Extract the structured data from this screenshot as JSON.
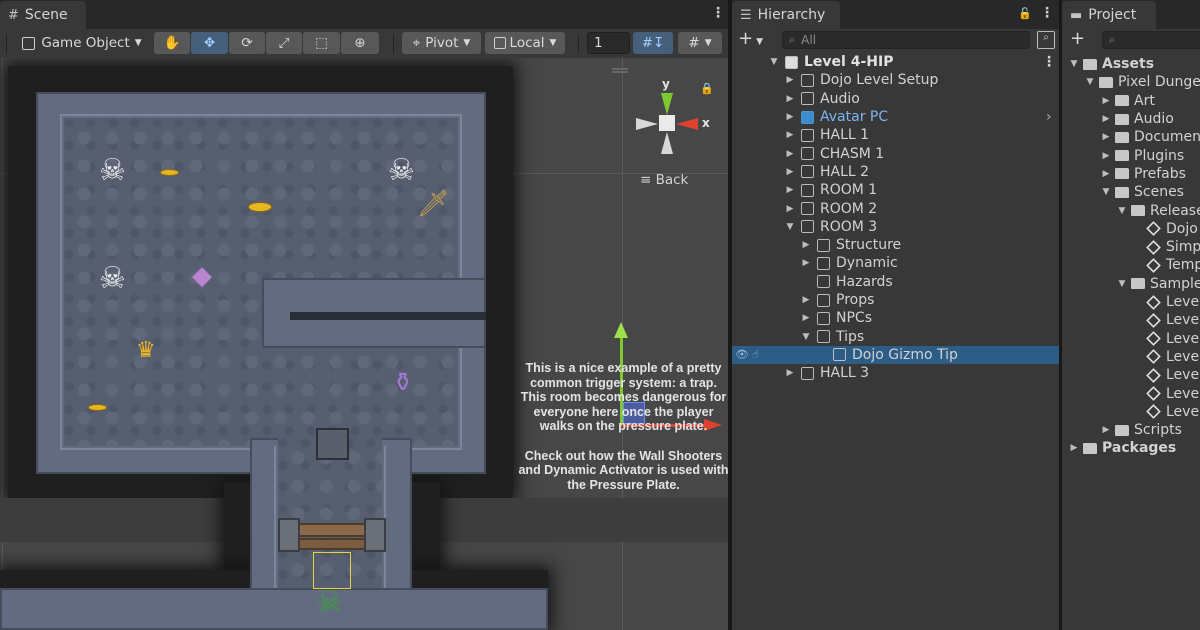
{
  "scene": {
    "tab_label": "Scene",
    "tab_icon": "grid-icon",
    "toolbar": {
      "object_mode": "Game Object",
      "pivot_label": "Pivot",
      "space_label": "Local",
      "grid_size": "1",
      "tools": [
        "hand-tool",
        "move-tool",
        "rotate-tool",
        "scale-tool",
        "rect-tool",
        "transform-tool"
      ],
      "active_tool": "move-tool"
    },
    "gizmo": {
      "y_label": "y",
      "x_label": "x",
      "back_label": "≡ Back"
    },
    "tip_paragraphs": [
      "This is a nice example of a pretty common trigger system: a trap. This room becomes dangerous for everyone here once the player walks on the pressure plate.",
      "Check out how the Wall Shooters and Dynamic Activator is used with the Pressure Plate."
    ]
  },
  "hierarchy": {
    "tab_label": "Hierarchy",
    "search_placeholder": "All",
    "add_label": "+",
    "rows": [
      {
        "label": "Level 4-HIP",
        "depth": 0,
        "expanded": true,
        "kind": "scene"
      },
      {
        "label": "Dojo Level Setup",
        "depth": 1,
        "expanded": false,
        "kind": "object"
      },
      {
        "label": "Audio",
        "depth": 1,
        "expanded": false,
        "kind": "object"
      },
      {
        "label": "Avatar PC",
        "depth": 1,
        "expanded": false,
        "kind": "prefab"
      },
      {
        "label": "HALL 1",
        "depth": 1,
        "expanded": false,
        "kind": "object"
      },
      {
        "label": "CHASM 1",
        "depth": 1,
        "expanded": false,
        "kind": "object"
      },
      {
        "label": "HALL 2",
        "depth": 1,
        "expanded": false,
        "kind": "object"
      },
      {
        "label": "ROOM 1",
        "depth": 1,
        "expanded": false,
        "kind": "object"
      },
      {
        "label": "ROOM 2",
        "depth": 1,
        "expanded": false,
        "kind": "object"
      },
      {
        "label": "ROOM 3",
        "depth": 1,
        "expanded": true,
        "kind": "object"
      },
      {
        "label": "Structure",
        "depth": 2,
        "expanded": false,
        "kind": "object"
      },
      {
        "label": "Dynamic",
        "depth": 2,
        "expanded": false,
        "kind": "object"
      },
      {
        "label": "Hazards",
        "depth": 2,
        "expanded": null,
        "kind": "object"
      },
      {
        "label": "Props",
        "depth": 2,
        "expanded": false,
        "kind": "object"
      },
      {
        "label": "NPCs",
        "depth": 2,
        "expanded": false,
        "kind": "object"
      },
      {
        "label": "Tips",
        "depth": 2,
        "expanded": true,
        "kind": "object"
      },
      {
        "label": "Dojo Gizmo Tip",
        "depth": 3,
        "expanded": null,
        "kind": "object",
        "selected": true
      },
      {
        "label": "HALL 3",
        "depth": 1,
        "expanded": false,
        "kind": "object"
      }
    ]
  },
  "project": {
    "tab_label": "Project",
    "add_label": "+",
    "rows": [
      {
        "label": "Assets",
        "depth": 0,
        "expanded": true,
        "kind": "folder",
        "bold": true
      },
      {
        "label": "Pixel Dungeon",
        "depth": 1,
        "expanded": true,
        "kind": "folder"
      },
      {
        "label": "Art",
        "depth": 2,
        "expanded": false,
        "kind": "folder"
      },
      {
        "label": "Audio",
        "depth": 2,
        "expanded": false,
        "kind": "folder"
      },
      {
        "label": "Documentation",
        "depth": 2,
        "expanded": false,
        "kind": "folder"
      },
      {
        "label": "Plugins",
        "depth": 2,
        "expanded": false,
        "kind": "folder"
      },
      {
        "label": "Prefabs",
        "depth": 2,
        "expanded": false,
        "kind": "folder"
      },
      {
        "label": "Scenes",
        "depth": 2,
        "expanded": true,
        "kind": "folder"
      },
      {
        "label": "Release",
        "depth": 3,
        "expanded": true,
        "kind": "folder"
      },
      {
        "label": "Dojo",
        "depth": 4,
        "expanded": null,
        "kind": "scene"
      },
      {
        "label": "Simple",
        "depth": 4,
        "expanded": null,
        "kind": "scene"
      },
      {
        "label": "Template",
        "depth": 4,
        "expanded": null,
        "kind": "scene"
      },
      {
        "label": "Sample",
        "depth": 3,
        "expanded": true,
        "kind": "folder"
      },
      {
        "label": "Level",
        "depth": 4,
        "expanded": null,
        "kind": "scene"
      },
      {
        "label": "Level",
        "depth": 4,
        "expanded": null,
        "kind": "scene"
      },
      {
        "label": "Level",
        "depth": 4,
        "expanded": null,
        "kind": "scene"
      },
      {
        "label": "Level",
        "depth": 4,
        "expanded": null,
        "kind": "scene"
      },
      {
        "label": "Level",
        "depth": 4,
        "expanded": null,
        "kind": "scene"
      },
      {
        "label": "Level",
        "depth": 4,
        "expanded": null,
        "kind": "scene"
      },
      {
        "label": "Level",
        "depth": 4,
        "expanded": null,
        "kind": "scene"
      },
      {
        "label": "Scripts",
        "depth": 2,
        "expanded": false,
        "kind": "folder"
      },
      {
        "label": "Packages",
        "depth": 0,
        "expanded": false,
        "kind": "folder",
        "bold": true
      }
    ]
  },
  "colors": {
    "accent_selected": "#2c5d87",
    "prefab_text": "#7bb5ef",
    "gizmo_y": "#7ec832",
    "gizmo_x": "#e0412c"
  }
}
